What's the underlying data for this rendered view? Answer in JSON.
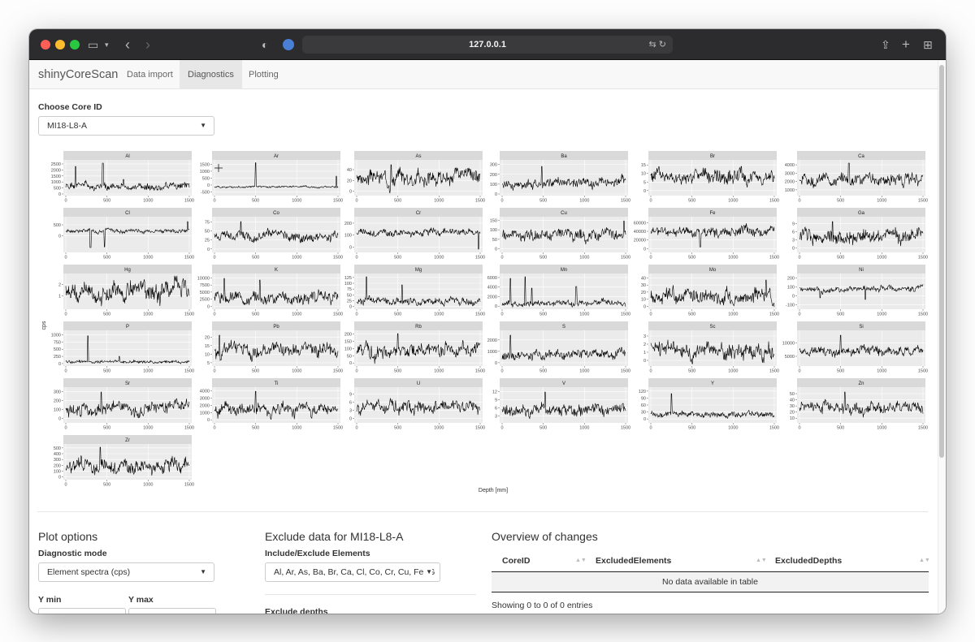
{
  "browser": {
    "url": "127.0.0.1",
    "back_icon": "chevron-left-icon",
    "forward_icon": "chevron-right-icon",
    "sidebar_icon": "sidebar-icon",
    "share_icon": "share-icon",
    "new_tab_icon": "plus-icon",
    "tabs_overview_icon": "grid-icon"
  },
  "navbar": {
    "brand": "shinyCoreScan",
    "tabs": [
      {
        "label": "Data import",
        "active": false
      },
      {
        "label": "Diagnostics",
        "active": true
      },
      {
        "label": "Plotting",
        "active": false
      }
    ]
  },
  "core_select": {
    "label": "Choose Core ID",
    "value": "MI18-L8-A"
  },
  "chart_data": {
    "type": "line",
    "ylabel": "cps",
    "xlabel": "Depth [mm]",
    "x_ticks": [
      0,
      500,
      1000,
      1500
    ],
    "xlim": [
      0,
      1500
    ],
    "panels": [
      {
        "name": "Al",
        "yticks": [
          0,
          500,
          1000,
          1500,
          2000,
          2500
        ],
        "ylim": [
          0,
          2700
        ],
        "baseline": 0.22,
        "noise": 0.15,
        "spikes": [
          [
            120,
            0.85
          ],
          [
            450,
            0.95
          ],
          [
            700,
            0.45
          ]
        ]
      },
      {
        "name": "Ar",
        "yticks": [
          -500,
          0,
          500,
          1000,
          1500
        ],
        "ylim": [
          -650,
          1700
        ],
        "baseline": 0.22,
        "noise": 0.04,
        "spikes": [
          [
            500,
            0.96
          ],
          [
            1480,
            0.55
          ]
        ]
      },
      {
        "name": "As",
        "yticks": [
          0,
          20,
          40
        ],
        "ylim": [
          -5,
          55
        ],
        "baseline": 0.5,
        "noise": 0.3,
        "spikes": [
          [
            420,
            0.9
          ]
        ]
      },
      {
        "name": "Ba",
        "yticks": [
          0,
          100,
          200,
          300
        ],
        "ylim": [
          0,
          330
        ],
        "baseline": 0.32,
        "noise": 0.2,
        "spikes": [
          [
            480,
            0.85
          ]
        ]
      },
      {
        "name": "Br",
        "yticks": [
          0,
          5,
          10,
          15
        ],
        "ylim": [
          -2,
          17
        ],
        "baseline": 0.5,
        "noise": 0.3,
        "spikes": [
          [
            1100,
            0.85
          ]
        ]
      },
      {
        "name": "Ca",
        "yticks": [
          1000,
          2000,
          3000,
          4000
        ],
        "ylim": [
          500,
          4400
        ],
        "baseline": 0.45,
        "noise": 0.25,
        "spikes": [
          [
            600,
            0.95
          ]
        ]
      },
      {
        "name": "Cl",
        "yticks": [
          0,
          500
        ],
        "ylim": [
          -700,
          800
        ],
        "baseline": 0.62,
        "noise": 0.08,
        "spikes": [
          [
            300,
            0.1
          ],
          [
            470,
            0.12
          ],
          [
            1480,
            0.9
          ]
        ]
      },
      {
        "name": "Co",
        "yticks": [
          0,
          25,
          50,
          75
        ],
        "ylim": [
          -5,
          85
        ],
        "baseline": 0.45,
        "noise": 0.2,
        "spikes": [
          [
            320,
            0.9
          ]
        ]
      },
      {
        "name": "Cr",
        "yticks": [
          0,
          100,
          200
        ],
        "ylim": [
          -30,
          240
        ],
        "baseline": 0.55,
        "noise": 0.15,
        "spikes": [
          [
            1480,
            0.05
          ]
        ]
      },
      {
        "name": "Cu",
        "yticks": [
          0,
          50,
          100,
          150
        ],
        "ylim": [
          -10,
          160
        ],
        "baseline": 0.5,
        "noise": 0.25,
        "spikes": [
          [
            1480,
            0.92
          ]
        ]
      },
      {
        "name": "Fe",
        "yticks": [
          0,
          20000,
          40000,
          60000
        ],
        "ylim": [
          -5000,
          70000
        ],
        "baseline": 0.6,
        "noise": 0.2,
        "spikes": [
          [
            600,
            0.12
          ]
        ]
      },
      {
        "name": "Ga",
        "yticks": [
          0,
          3,
          6,
          9
        ],
        "ylim": [
          -1,
          11
        ],
        "baseline": 0.45,
        "noise": 0.3,
        "spikes": [
          [
            400,
            0.9
          ]
        ]
      },
      {
        "name": "Hg",
        "yticks": [
          1,
          2
        ],
        "ylim": [
          0,
          2.8
        ],
        "baseline": 0.5,
        "noise": 0.38,
        "spikes": []
      },
      {
        "name": "K",
        "yticks": [
          0,
          2500,
          5000,
          7500,
          10000
        ],
        "ylim": [
          -500,
          11000
        ],
        "baseline": 0.3,
        "noise": 0.25,
        "spikes": [
          [
            120,
            0.9
          ],
          [
            550,
            0.85
          ]
        ]
      },
      {
        "name": "Mg",
        "yticks": [
          0,
          25,
          50,
          75,
          100,
          125
        ],
        "ylim": [
          -5,
          135
        ],
        "baseline": 0.2,
        "noise": 0.15,
        "spikes": [
          [
            120,
            0.95
          ],
          [
            550,
            0.7
          ]
        ]
      },
      {
        "name": "Mn",
        "yticks": [
          0,
          2000,
          4000,
          6000
        ],
        "ylim": [
          -300,
          6500
        ],
        "baseline": 0.12,
        "noise": 0.12,
        "spikes": [
          [
            100,
            0.9
          ],
          [
            280,
            0.95
          ],
          [
            360,
            0.6
          ],
          [
            900,
            0.65
          ]
        ]
      },
      {
        "name": "Mo",
        "yticks": [
          0,
          10,
          20,
          30,
          40
        ],
        "ylim": [
          -2,
          44
        ],
        "baseline": 0.35,
        "noise": 0.3,
        "spikes": [
          [
            1400,
            0.85
          ]
        ]
      },
      {
        "name": "Ni",
        "yticks": [
          -100,
          0,
          100,
          200
        ],
        "ylim": [
          -130,
          230
        ],
        "baseline": 0.55,
        "noise": 0.12,
        "spikes": [
          [
            250,
            0.3
          ],
          [
            800,
            0.25
          ]
        ]
      },
      {
        "name": "P",
        "yticks": [
          0,
          250,
          500,
          750,
          1000
        ],
        "ylim": [
          -30,
          1100
        ],
        "baseline": 0.08,
        "noise": 0.06,
        "spikes": [
          [
            270,
            0.88
          ],
          [
            650,
            0.25
          ]
        ]
      },
      {
        "name": "Pb",
        "yticks": [
          5,
          10,
          15,
          20
        ],
        "ylim": [
          4,
          23
        ],
        "baseline": 0.45,
        "noise": 0.28,
        "spikes": [
          [
            60,
            0.9
          ]
        ]
      },
      {
        "name": "Rb",
        "yticks": [
          0,
          50,
          100,
          150,
          200
        ],
        "ylim": [
          -10,
          215
        ],
        "baseline": 0.45,
        "noise": 0.3,
        "spikes": [
          [
            500,
            0.95
          ]
        ]
      },
      {
        "name": "S",
        "yticks": [
          0,
          1000,
          2000
        ],
        "ylim": [
          -150,
          2700
        ],
        "baseline": 0.3,
        "noise": 0.2,
        "spikes": [
          [
            100,
            0.9
          ]
        ]
      },
      {
        "name": "Sc",
        "yticks": [
          0,
          1,
          2,
          3
        ],
        "ylim": [
          -0.5,
          3.5
        ],
        "baseline": 0.45,
        "noise": 0.35,
        "spikes": []
      },
      {
        "name": "Si",
        "yticks": [
          5000,
          10000
        ],
        "ylim": [
          2000,
          14000
        ],
        "baseline": 0.4,
        "noise": 0.2,
        "spikes": [
          [
            500,
            0.9
          ]
        ]
      },
      {
        "name": "Sr",
        "yticks": [
          0,
          100,
          200,
          300
        ],
        "ylim": [
          -30,
          330
        ],
        "baseline": 0.4,
        "noise": 0.25,
        "spikes": [
          [
            430,
            0.9
          ]
        ]
      },
      {
        "name": "Ti",
        "yticks": [
          0,
          1000,
          2000,
          3000,
          4000
        ],
        "ylim": [
          -200,
          4300
        ],
        "baseline": 0.4,
        "noise": 0.25,
        "spikes": [
          [
            500,
            0.92
          ]
        ]
      },
      {
        "name": "U",
        "yticks": [
          0,
          3,
          6,
          9
        ],
        "ylim": [
          -1,
          11
        ],
        "baseline": 0.45,
        "noise": 0.25,
        "spikes": []
      },
      {
        "name": "V",
        "yticks": [
          3,
          6,
          9,
          12
        ],
        "ylim": [
          1,
          13
        ],
        "baseline": 0.35,
        "noise": 0.25,
        "spikes": [
          [
            520,
            0.9
          ]
        ]
      },
      {
        "name": "Y",
        "yticks": [
          0,
          30,
          60,
          90,
          120
        ],
        "ylim": [
          -10,
          130
        ],
        "baseline": 0.2,
        "noise": 0.12,
        "spikes": [
          [
            250,
            0.85
          ]
        ]
      },
      {
        "name": "Zn",
        "yticks": [
          10,
          20,
          30,
          40,
          50
        ],
        "ylim": [
          5,
          58
        ],
        "baseline": 0.4,
        "noise": 0.25,
        "spikes": [
          [
            550,
            0.9
          ]
        ]
      },
      {
        "name": "Zr",
        "yticks": [
          0,
          100,
          200,
          300,
          400,
          500
        ],
        "ylim": [
          -20,
          540
        ],
        "baseline": 0.35,
        "noise": 0.3,
        "spikes": [
          [
            420,
            0.95
          ]
        ]
      }
    ]
  },
  "plot_options": {
    "heading": "Plot options",
    "mode_label": "Diagnostic mode",
    "mode_value": "Element spectra (cps)",
    "ymin_label": "Y min",
    "ymax_label": "Y max"
  },
  "exclude": {
    "heading": "Exclude data for MI18-L8-A",
    "elements_label": "Include/Exclude Elements",
    "elements_value": "Al, Ar, As, Ba, Br, Ca, Cl, Co, Cr, Cu, Fe, G",
    "depths_label": "Exclude depths"
  },
  "overview": {
    "heading": "Overview of changes",
    "columns": [
      "CoreID",
      "ExcludedElements",
      "ExcludedDepths"
    ],
    "empty_text": "No data available in table",
    "info": "Showing 0 to 0 of 0 entries"
  }
}
